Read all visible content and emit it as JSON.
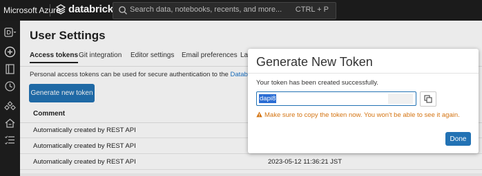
{
  "topbar": {
    "brand_left": "Microsoft Azure",
    "brand": "databricks",
    "search_placeholder": "Search data, notebooks, recents, and more...",
    "search_shortcut": "CTRL + P"
  },
  "sidebar": {
    "icons": [
      "workspace-switcher-icon",
      "new-icon",
      "workspace-icon",
      "recents-icon",
      "data-icon",
      "compute-icon",
      "workflows-icon"
    ]
  },
  "page": {
    "title": "User Settings",
    "tabs": [
      {
        "label": "Access tokens",
        "active": true
      },
      {
        "label": "Git integration",
        "active": false
      },
      {
        "label": "Editor settings",
        "active": false
      },
      {
        "label": "Email preferences",
        "active": false
      },
      {
        "label": "La",
        "active": false
      }
    ],
    "description_prefix": "Personal access tokens can be used for secure authentication to the ",
    "description_link": "Databricks API",
    "generate_button": "Generate new token"
  },
  "table": {
    "headers": {
      "comment": "Comment"
    },
    "rows": [
      {
        "comment": "Automatically created by REST API",
        "created": ""
      },
      {
        "comment": "Automatically created by REST API",
        "created": ""
      },
      {
        "comment": "Automatically created by REST API",
        "created": "2023-05-12 11:36:21 JST"
      }
    ]
  },
  "modal": {
    "title": "Generate New Token",
    "message": "Your token has been created successfully.",
    "token_value": "dapi8",
    "warning": "Make sure to copy the token now. You won't be able to see it again.",
    "done_label": "Done"
  },
  "colors": {
    "accent": "#2272b4",
    "topbar": "#1b1b1b",
    "warning": "#d47412"
  }
}
